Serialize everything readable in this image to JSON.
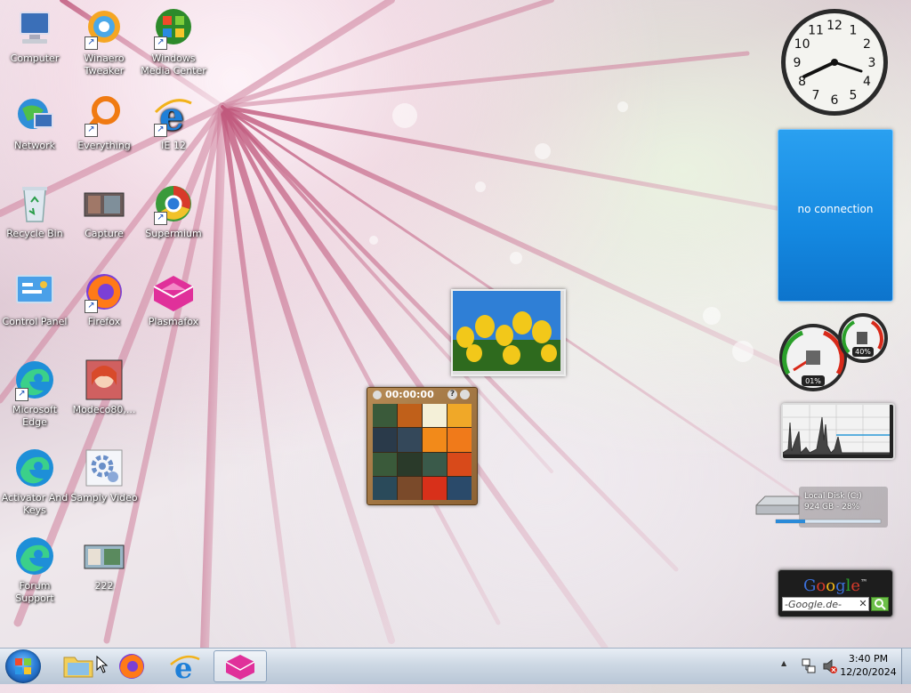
{
  "desktop": {
    "icons": [
      {
        "label": "Computer"
      },
      {
        "label": "Winaero Tweaker"
      },
      {
        "label": "Windows Media Center"
      },
      {
        "label": "Network"
      },
      {
        "label": "Everything"
      },
      {
        "label": "IE 12"
      },
      {
        "label": "Recycle Bin"
      },
      {
        "label": "Capture"
      },
      {
        "label": "Supermium"
      },
      {
        "label": "Control Panel"
      },
      {
        "label": "Firefox"
      },
      {
        "label": "Plasmafox"
      },
      {
        "label": "Microsoft Edge"
      },
      {
        "label": "Modeco80,..."
      },
      {
        "label": "Activator And Keys"
      },
      {
        "label": "Samply Video"
      },
      {
        "label": "Forum Support"
      },
      {
        "label": "222"
      }
    ]
  },
  "gadgets": {
    "clock": {
      "time": "8:20",
      "numbers": [
        "12",
        "1",
        "2",
        "3",
        "4",
        "5",
        "6",
        "7",
        "8",
        "9",
        "10",
        "11"
      ]
    },
    "weather": {
      "status": "no connection"
    },
    "puzzle": {
      "timer": "00:00:00",
      "help": "?"
    },
    "meter": {
      "cpu": "01%",
      "ram": "40%"
    },
    "disk": {
      "name": "Local Disk (C:)",
      "size": "924 GB - 28%",
      "used_fraction": 0.28
    },
    "google": {
      "logo": "Google",
      "tm": "™",
      "search_text": "-Google.de-",
      "clear": "✕"
    }
  },
  "taskbar": {
    "clock_time": "3:40 PM",
    "clock_date": "12/20/2024",
    "tray_up": "▲"
  },
  "colors": {
    "taskbar": "#cdd8e4",
    "weather_blue": "#1488e0",
    "start_orb": "#2c7fd8"
  }
}
